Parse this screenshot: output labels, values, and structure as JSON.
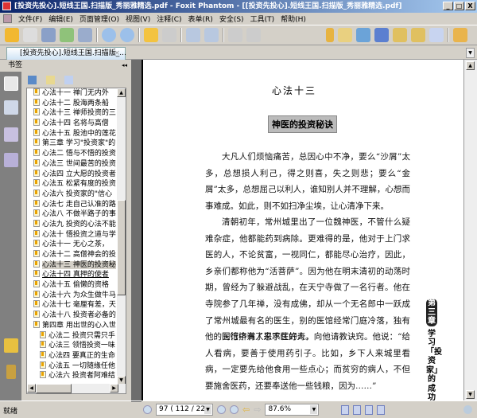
{
  "window": {
    "title": "[投资先投心].短线王国.扫描版_秀丽雅精选.pdf - Foxit Phantom - [[投资先投心].短线王国.扫描版_秀丽雅精选.pdf]",
    "min": "_",
    "max": "□",
    "close": "X"
  },
  "menu": [
    "文件(F)",
    "编辑(E)",
    "页面管理(O)",
    "视图(V)",
    "注释(C)",
    "表单(R)",
    "安全(S)",
    "工具(T)",
    "帮助(H)"
  ],
  "tab": {
    "label": "[投资先投心].短线王国.扫描版_...",
    "close": "×"
  },
  "panel": {
    "title": "书签",
    "collapse": "◂◂"
  },
  "bookmarks": [
    {
      "label": "心法十一  禅门无内外",
      "indent": false
    },
    {
      "label": "心法十二  股海两条船",
      "indent": false
    },
    {
      "label": "心法十三  禅师投资的三",
      "indent": false
    },
    {
      "label": "心法十四  名将与高僧",
      "indent": false
    },
    {
      "label": "心法十五  股池中的莲花",
      "indent": false
    },
    {
      "label": "第三章  学习\"投资家\"的",
      "indent": false
    },
    {
      "label": "心法二  悟与不悟的投资",
      "indent": false
    },
    {
      "label": "心法三  世间最苦的投资",
      "indent": false
    },
    {
      "label": "心法四  立大愿的投资者",
      "indent": false
    },
    {
      "label": "心法五  松紧有度的投资",
      "indent": false
    },
    {
      "label": "心法六  投资家的\"信心",
      "indent": false
    },
    {
      "label": "心法七  走自己认准的路",
      "indent": false
    },
    {
      "label": "心法八  不做半路子的事",
      "indent": false
    },
    {
      "label": "心法九  投资的心法不能",
      "indent": false
    },
    {
      "label": "心法十  悟投资之道与学",
      "indent": false
    },
    {
      "label": "心法十一  无心之茶，",
      "indent": false
    },
    {
      "label": "心法十二  高僧神会的投",
      "indent": false
    },
    {
      "label": "心法十三  神医的投资秘",
      "indent": false,
      "selected": true
    },
    {
      "label": "心法十四  真押的使者",
      "indent": false,
      "hover": true
    },
    {
      "label": "心法十五  偷懒的资格",
      "indent": false
    },
    {
      "label": "心法十六  为众生做牛马",
      "indent": false
    },
    {
      "label": "心法十七  毫厘有差，天",
      "indent": false
    },
    {
      "label": "心法十八  投资者必备的",
      "indent": false
    },
    {
      "label": "第四章  用出世的心入世",
      "indent": false
    },
    {
      "label": "心法二  投资只需只手",
      "indent": true
    },
    {
      "label": "心法三  领悟投资一味",
      "indent": true
    },
    {
      "label": "心法四  要真正的生命",
      "indent": true
    },
    {
      "label": "心法五  一切随缘任他",
      "indent": true
    },
    {
      "label": "心法六  投资者阿难结",
      "indent": true
    }
  ],
  "page": {
    "chapter": "心法十三",
    "heading": "神医的投资秘诀",
    "paragraphs": [
      "大凡人们烦恼痛苦，总因心中不净，要么“沙屑”太多，总想损人利己，得之则喜，失之则悲；要么“金屑”太多，总想屈己以利人，谁知别人并不理解，心想而事难成。如此，则不如扫净尘埃，让心清净下来。",
      "清朝初年，常州城里出了一位魏神医，不管什么疑难杂症，他都能药到病除。更难得的是，他对于上门求医的人，不论贫富，一视同仁，都能尽心治疗，因此，乡亲们都称他为“活菩萨”。因为他在明末清初的动荡时期，曾经为了躲避战乱，在天宁寺做了一名行者。他在寺院参了几年禅，没有成佛，却从一个无名郎中一跃成了常州城最有名的医生，别的医馆经常门庭冷落，独有他的医馆挤满了来求医的人。",
      "同行中有人忍不住好奇，向他请教诀窍。他说：“给人看病，要善于使用药引子。比如，乡下人来城里看病，一定要先给他食用一些点心；而贫穷的病人，不但要施舍医药，还要奉送他一些钱粮，因为……”"
    ],
    "side_chapter": "第三章",
    "side_title": "学习「投资家」的成功思维"
  },
  "status": {
    "text": "就绪"
  },
  "nav": {
    "page_input": "97 ( 112 / 222",
    "zoom": "87.6%"
  }
}
